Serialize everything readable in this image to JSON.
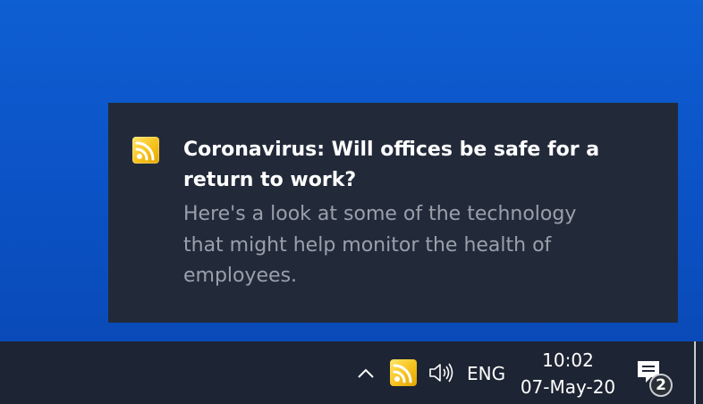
{
  "notification": {
    "app_icon": "rss-feed-icon",
    "title": "Coronavirus: Will offices be safe for a return to work?",
    "body": "Here's a look at some of the technology that might help monitor the health of employees."
  },
  "taskbar": {
    "tray_items": [
      {
        "icon": "chevron-up-icon"
      },
      {
        "icon": "rss-feed-icon"
      },
      {
        "icon": "speaker-icon"
      }
    ],
    "language": "ENG",
    "time": "10:02",
    "date": "07-May-20",
    "notification_count": "2"
  },
  "colors": {
    "desktop": "#0b52c6",
    "toast_background": "#222a3a",
    "taskbar": "#1d2433",
    "rss_icon": "#f6c21d"
  }
}
